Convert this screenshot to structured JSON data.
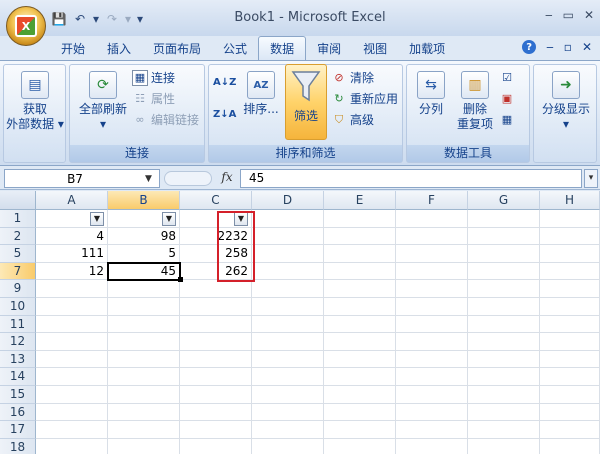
{
  "window": {
    "title": "Book1 - Microsoft Excel",
    "min": "‒",
    "max": "▭",
    "close": "✕"
  },
  "office_button": {
    "glyph": "X"
  },
  "quick_access": {
    "save": "💾",
    "undo": "↶",
    "undo_arrow": "▾",
    "redo": "↷",
    "redo_arrow": "▾",
    "customize": "▾"
  },
  "tabs": [
    "开始",
    "插入",
    "页面布局",
    "公式",
    "数据",
    "审阅",
    "视图",
    "加载项"
  ],
  "active_tab": "数据",
  "tab_right": {
    "help": "?",
    "min": "‒",
    "restore": "▫",
    "close": "✕"
  },
  "ribbon": {
    "get_external_data": {
      "label1": "获取",
      "label2": "外部数据",
      "arrow": "▾"
    },
    "connections": {
      "refresh_all": "全部刷新",
      "refresh_arrow": "▾",
      "connections": "连接",
      "properties": "属性",
      "edit_links": "编辑链接",
      "group_label": "连接"
    },
    "sort_filter": {
      "sort_az": "A↓Z",
      "sort_za": "Z↓A",
      "sort": "排序...",
      "filter": "筛选",
      "clear": "清除",
      "reapply": "重新应用",
      "advanced": "高级",
      "group_label": "排序和筛选"
    },
    "data_tools": {
      "text_to_columns": "分列",
      "remove_duplicates1": "删除",
      "remove_duplicates2": "重复项",
      "group_label": "数据工具"
    },
    "outline": {
      "label": "分级显示",
      "arrow": "▾"
    }
  },
  "formula_bar": {
    "name_box": "B7",
    "fx": "fx",
    "value": "45",
    "expand": "▾"
  },
  "columns": [
    "A",
    "B",
    "C",
    "D",
    "E",
    "F",
    "G",
    "H"
  ],
  "selected_column": "B",
  "rows": [
    {
      "num": "1",
      "cells": [
        "",
        "",
        "",
        "",
        "",
        "",
        "",
        ""
      ]
    },
    {
      "num": "2",
      "cells": [
        "4",
        "98",
        "2232",
        "",
        "",
        "",
        "",
        ""
      ]
    },
    {
      "num": "5",
      "cells": [
        "111",
        "5",
        "258",
        "",
        "",
        "",
        "",
        ""
      ]
    },
    {
      "num": "7",
      "cells": [
        "12",
        "45",
        "262",
        "",
        "",
        "",
        "",
        ""
      ]
    },
    {
      "num": "9",
      "cells": []
    },
    {
      "num": "10",
      "cells": []
    },
    {
      "num": "11",
      "cells": []
    },
    {
      "num": "12",
      "cells": []
    },
    {
      "num": "13",
      "cells": []
    },
    {
      "num": "14",
      "cells": []
    },
    {
      "num": "15",
      "cells": []
    },
    {
      "num": "16",
      "cells": []
    },
    {
      "num": "17",
      "cells": []
    },
    {
      "num": "18",
      "cells": []
    }
  ],
  "selected_row": "7",
  "filter_dropdowns": {
    "a": "▼",
    "b": "▼",
    "c": "▼"
  },
  "colors": {
    "accent": "#15428b",
    "highlight_box": "#d4202a",
    "selected_header": "#f9cb6b"
  }
}
